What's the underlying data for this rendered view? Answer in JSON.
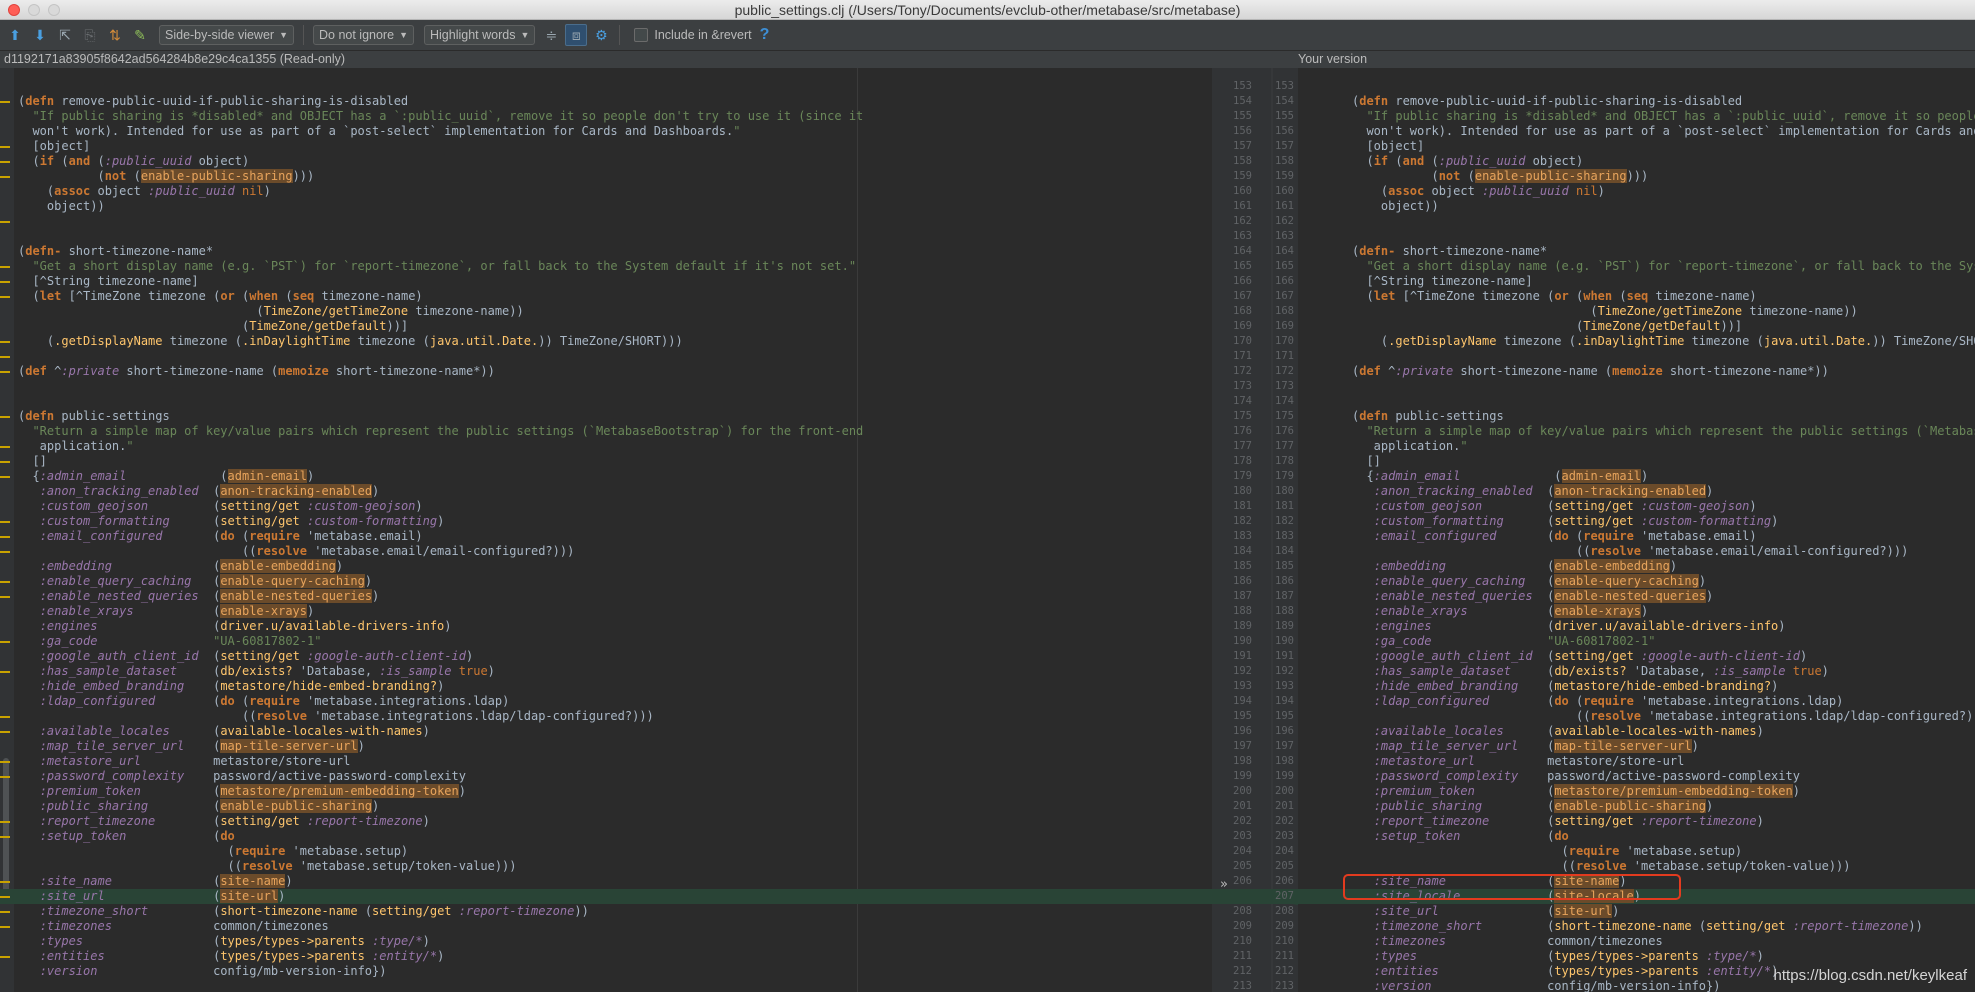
{
  "window": {
    "title": "public_settings.clj (/Users/Tony/Documents/evclub-other/metabase/src/metabase)"
  },
  "toolbar": {
    "viewer_mode": "Side-by-side viewer",
    "ignore_mode": "Do not ignore",
    "highlight_mode": "Highlight words",
    "include_label": "Include in &revert",
    "help": "?"
  },
  "left_pane": {
    "header": "d1192171a83905f8642ad564284b8e29c4ca1355 (Read-only)"
  },
  "right_pane": {
    "header": "Your version"
  },
  "watermark": "https://blog.csdn.net/keylkeaf",
  "colors": {
    "keyword": "#cc7832",
    "string": "#6a8759",
    "symbol": "#9876aa",
    "function": "#ffc66d",
    "added_line": "#294436",
    "callout": "#e23b1f"
  },
  "left_lines": [
    "",
    "(defn remove-public-uuid-if-public-sharing-is-disabled",
    "  \"If public sharing is *disabled* and OBJECT has a `:public_uuid`, remove it so people don't try to use it (since it",
    "  won't work). Intended for use as part of a `post-select` implementation for Cards and Dashboards.\"",
    "  [object]",
    "  (if (and (:public_uuid object)",
    "           (not (enable-public-sharing)))",
    "    (assoc object :public_uuid nil)",
    "    object))",
    "",
    "",
    "(defn- short-timezone-name*",
    "  \"Get a short display name (e.g. `PST`) for `report-timezone`, or fall back to the System default if it's not set.\"",
    "  [^String timezone-name]",
    "  (let [^TimeZone timezone (or (when (seq timezone-name)",
    "                                 (TimeZone/getTimeZone timezone-name))",
    "                               (TimeZone/getDefault))]",
    "    (.getDisplayName timezone (.inDaylightTime timezone (java.util.Date.)) TimeZone/SHORT)))",
    "",
    "(def ^:private short-timezone-name (memoize short-timezone-name*))",
    "",
    "",
    "(defn public-settings",
    "  \"Return a simple map of key/value pairs which represent the public settings (`MetabaseBootstrap`) for the front-end",
    "   application.\"",
    "  []",
    "  {:admin_email             (admin-email)",
    "   :anon_tracking_enabled  (anon-tracking-enabled)",
    "   :custom_geojson         (setting/get :custom-geojson)",
    "   :custom_formatting      (setting/get :custom-formatting)",
    "   :email_configured       (do (require 'metabase.email)",
    "                               ((resolve 'metabase.email/email-configured?)))",
    "   :embedding              (enable-embedding)",
    "   :enable_query_caching   (enable-query-caching)",
    "   :enable_nested_queries  (enable-nested-queries)",
    "   :enable_xrays           (enable-xrays)",
    "   :engines                (driver.u/available-drivers-info)",
    "   :ga_code                \"UA-60817802-1\"",
    "   :google_auth_client_id  (setting/get :google-auth-client-id)",
    "   :has_sample_dataset     (db/exists? 'Database, :is_sample true)",
    "   :hide_embed_branding    (metastore/hide-embed-branding?)",
    "   :ldap_configured        (do (require 'metabase.integrations.ldap)",
    "                               ((resolve 'metabase.integrations.ldap/ldap-configured?)))",
    "   :available_locales      (available-locales-with-names)",
    "   :map_tile_server_url    (map-tile-server-url)",
    "   :metastore_url          metastore/store-url",
    "   :password_complexity    password/active-password-complexity",
    "   :premium_token          (metastore/premium-embedding-token)",
    "   :public_sharing         (enable-public-sharing)",
    "   :report_timezone        (setting/get :report-timezone)",
    "   :setup_token            (do",
    "                             (require 'metabase.setup)",
    "                             ((resolve 'metabase.setup/token-value)))",
    "   :site_name              (site-name)",
    "   :site_url               (site-url)",
    "   :timezone_short         (short-timezone-name (setting/get :report-timezone))",
    "   :timezones              common/timezones",
    "   :types                  (types/types->parents :type/*)",
    "   :entities               (types/types->parents :entity/*)",
    "   :version                config/mb-version-info})"
  ],
  "right_lines": [
    {
      "left": "153",
      "right": "153",
      "code": ""
    },
    {
      "left": "154",
      "right": "154",
      "code": "(defn remove-public-uuid-if-public-sharing-is-disabled"
    },
    {
      "left": "155",
      "right": "155",
      "code": "  \"If public sharing is *disabled* and OBJECT has a `:public_uuid`, remove it so people d"
    },
    {
      "left": "156",
      "right": "156",
      "code": "  won't work). Intended for use as part of a `post-select` implementation for Cards and"
    },
    {
      "left": "157",
      "right": "157",
      "code": "  [object]"
    },
    {
      "left": "158",
      "right": "158",
      "code": "  (if (and (:public_uuid object)"
    },
    {
      "left": "159",
      "right": "159",
      "code": "           (not (enable-public-sharing)))"
    },
    {
      "left": "160",
      "right": "160",
      "code": "    (assoc object :public_uuid nil)"
    },
    {
      "left": "161",
      "right": "161",
      "code": "    object))"
    },
    {
      "left": "162",
      "right": "162",
      "code": ""
    },
    {
      "left": "163",
      "right": "163",
      "code": ""
    },
    {
      "left": "164",
      "right": "164",
      "code": "(defn- short-timezone-name*"
    },
    {
      "left": "165",
      "right": "165",
      "code": "  \"Get a short display name (e.g. `PST`) for `report-timezone`, or fall back to the Syste"
    },
    {
      "left": "166",
      "right": "166",
      "code": "  [^String timezone-name]"
    },
    {
      "left": "167",
      "right": "167",
      "code": "  (let [^TimeZone timezone (or (when (seq timezone-name)"
    },
    {
      "left": "168",
      "right": "168",
      "code": "                                 (TimeZone/getTimeZone timezone-name))"
    },
    {
      "left": "169",
      "right": "169",
      "code": "                               (TimeZone/getDefault))]"
    },
    {
      "left": "170",
      "right": "170",
      "code": "    (.getDisplayName timezone (.inDaylightTime timezone (java.util.Date.)) TimeZone/SHORT"
    },
    {
      "left": "171",
      "right": "171",
      "code": ""
    },
    {
      "left": "172",
      "right": "172",
      "code": "(def ^:private short-timezone-name (memoize short-timezone-name*))"
    },
    {
      "left": "173",
      "right": "173",
      "code": ""
    },
    {
      "left": "174",
      "right": "174",
      "code": ""
    },
    {
      "left": "175",
      "right": "175",
      "code": "(defn public-settings"
    },
    {
      "left": "176",
      "right": "176",
      "code": "  \"Return a simple map of key/value pairs which represent the public settings (`MetabaseB"
    },
    {
      "left": "177",
      "right": "177",
      "code": "   application.\""
    },
    {
      "left": "178",
      "right": "178",
      "code": "  []"
    },
    {
      "left": "179",
      "right": "179",
      "code": "  {:admin_email             (admin-email)"
    },
    {
      "left": "180",
      "right": "180",
      "code": "   :anon_tracking_enabled  (anon-tracking-enabled)"
    },
    {
      "left": "181",
      "right": "181",
      "code": "   :custom_geojson         (setting/get :custom-geojson)"
    },
    {
      "left": "182",
      "right": "182",
      "code": "   :custom_formatting      (setting/get :custom-formatting)"
    },
    {
      "left": "183",
      "right": "183",
      "code": "   :email_configured       (do (require 'metabase.email)"
    },
    {
      "left": "184",
      "right": "184",
      "code": "                               ((resolve 'metabase.email/email-configured?)))"
    },
    {
      "left": "185",
      "right": "185",
      "code": "   :embedding              (enable-embedding)"
    },
    {
      "left": "186",
      "right": "186",
      "code": "   :enable_query_caching   (enable-query-caching)"
    },
    {
      "left": "187",
      "right": "187",
      "code": "   :enable_nested_queries  (enable-nested-queries)"
    },
    {
      "left": "188",
      "right": "188",
      "code": "   :enable_xrays           (enable-xrays)"
    },
    {
      "left": "189",
      "right": "189",
      "code": "   :engines                (driver.u/available-drivers-info)"
    },
    {
      "left": "190",
      "right": "190",
      "code": "   :ga_code                \"UA-60817802-1\""
    },
    {
      "left": "191",
      "right": "191",
      "code": "   :google_auth_client_id  (setting/get :google-auth-client-id)"
    },
    {
      "left": "192",
      "right": "192",
      "code": "   :has_sample_dataset     (db/exists? 'Database, :is_sample true)"
    },
    {
      "left": "193",
      "right": "193",
      "code": "   :hide_embed_branding    (metastore/hide-embed-branding?)"
    },
    {
      "left": "194",
      "right": "194",
      "code": "   :ldap_configured        (do (require 'metabase.integrations.ldap)"
    },
    {
      "left": "195",
      "right": "195",
      "code": "                               ((resolve 'metabase.integrations.ldap/ldap-configured?)))"
    },
    {
      "left": "196",
      "right": "196",
      "code": "   :available_locales      (available-locales-with-names)"
    },
    {
      "left": "197",
      "right": "197",
      "code": "   :map_tile_server_url    (map-tile-server-url)"
    },
    {
      "left": "198",
      "right": "198",
      "code": "   :metastore_url          metastore/store-url"
    },
    {
      "left": "199",
      "right": "199",
      "code": "   :password_complexity    password/active-password-complexity"
    },
    {
      "left": "200",
      "right": "200",
      "code": "   :premium_token          (metastore/premium-embedding-token)"
    },
    {
      "left": "201",
      "right": "201",
      "code": "   :public_sharing         (enable-public-sharing)"
    },
    {
      "left": "202",
      "right": "202",
      "code": "   :report_timezone        (setting/get :report-timezone)"
    },
    {
      "left": "203",
      "right": "203",
      "code": "   :setup_token            (do"
    },
    {
      "left": "204",
      "right": "204",
      "code": "                             (require 'metabase.setup)"
    },
    {
      "left": "205",
      "right": "205",
      "code": "                             ((resolve 'metabase.setup/token-value)))"
    },
    {
      "left": "206",
      "right": "206",
      "code": "   :site_name              (site-name)"
    },
    {
      "left": "207",
      "right": "207",
      "code": "   :site_locale            (site-locale)"
    },
    {
      "left": "208",
      "right": "208",
      "code": "   :site_url               (site-url)"
    },
    {
      "left": "209",
      "right": "209",
      "code": "   :timezone_short         (short-timezone-name (setting/get :report-timezone))"
    },
    {
      "left": "210",
      "right": "210",
      "code": "   :timezones              common/timezones"
    },
    {
      "left": "211",
      "right": "211",
      "code": "   :types                  (types/types->parents :type/*)"
    },
    {
      "left": "212",
      "right": "212",
      "code": "   :entities               (types/types->parents :entity/*)"
    },
    {
      "left": "213",
      "right": "213",
      "code": "   :version                config/mb-version-info})"
    },
    {
      "left": "214",
      "right": "214",
      "code": ""
    }
  ]
}
